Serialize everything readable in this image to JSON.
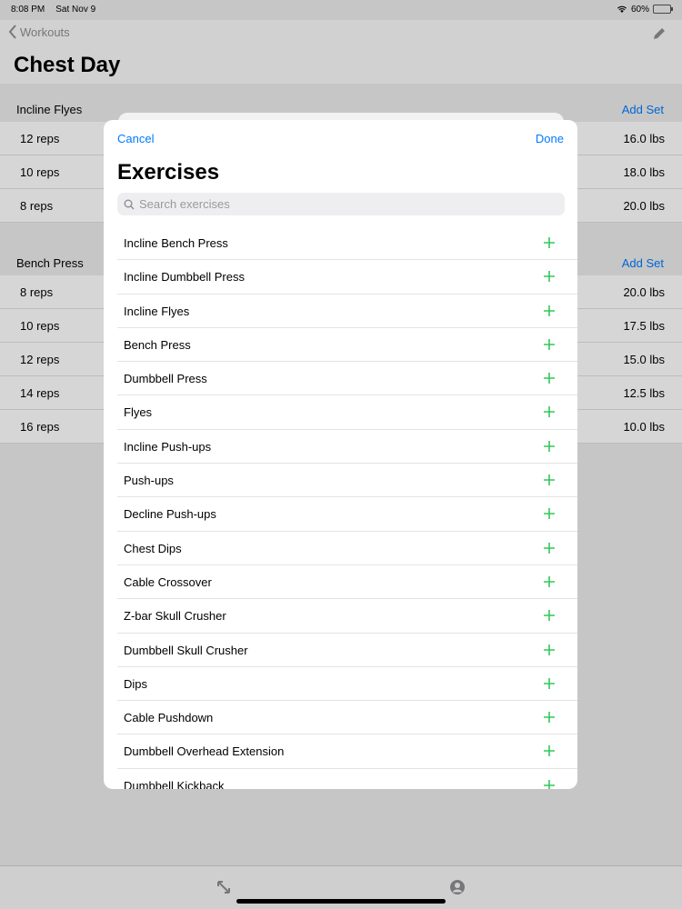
{
  "status": {
    "time": "8:08 PM",
    "date": "Sat Nov 9",
    "battery": "60%",
    "battery_level": 0.6
  },
  "nav": {
    "back_label": "Workouts",
    "title": "Chest Day"
  },
  "sections": [
    {
      "name": "Incline Flyes",
      "add_label": "Add Set",
      "sets": [
        {
          "reps": "12 reps",
          "weight": "16.0 lbs"
        },
        {
          "reps": "10 reps",
          "weight": "18.0 lbs"
        },
        {
          "reps": "8 reps",
          "weight": "20.0 lbs"
        }
      ]
    },
    {
      "name": "Bench Press",
      "add_label": "Add Set",
      "sets": [
        {
          "reps": "8 reps",
          "weight": "20.0 lbs"
        },
        {
          "reps": "10 reps",
          "weight": "17.5 lbs"
        },
        {
          "reps": "12 reps",
          "weight": "15.0 lbs"
        },
        {
          "reps": "14 reps",
          "weight": "12.5 lbs"
        },
        {
          "reps": "16 reps",
          "weight": "10.0 lbs"
        }
      ]
    }
  ],
  "modal": {
    "cancel_label": "Cancel",
    "done_label": "Done",
    "title": "Exercises",
    "search_placeholder": "Search exercises",
    "exercises": [
      "Incline Bench Press",
      "Incline Dumbbell Press",
      "Incline Flyes",
      "Bench Press",
      "Dumbbell Press",
      "Flyes",
      "Incline Push-ups",
      "Push-ups",
      "Decline Push-ups",
      "Chest Dips",
      "Cable Crossover",
      "Z-bar Skull Crusher",
      "Dumbbell Skull Crusher",
      "Dips",
      "Cable Pushdown",
      "Dumbbell Overhead Extension",
      "Dumbbell Kickback"
    ]
  },
  "colors": {
    "accent": "#007aff",
    "add_icon": "#34c759"
  },
  "icons": {
    "back": "chevron-left-icon",
    "edit": "pencil-icon",
    "search": "search-icon",
    "add": "plus-icon",
    "tab1": "expand-arrows-icon",
    "tab2": "person-icon"
  }
}
